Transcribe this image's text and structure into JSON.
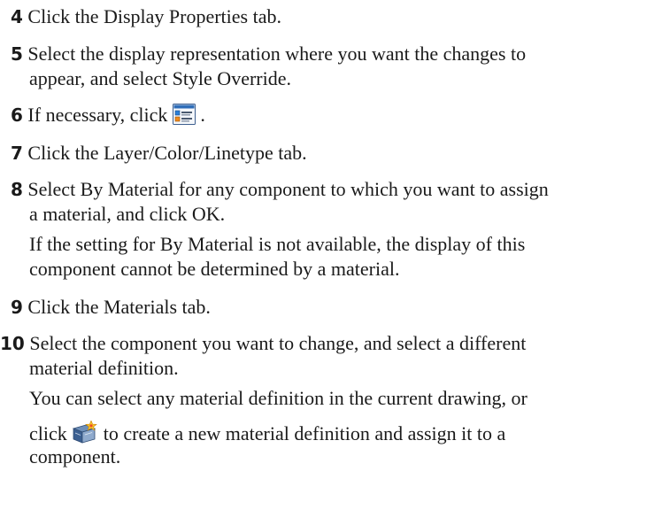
{
  "steps": [
    {
      "num": "4",
      "text": " Click the Display Properties tab."
    },
    {
      "num": "5",
      "line1": " Select the display representation where you want the changes to",
      "line2": "appear, and select Style Override."
    },
    {
      "num": "6",
      "before": " If necessary, click ",
      "after": " .",
      "icon": "display-properties-icon"
    },
    {
      "num": "7",
      "text": " Click the Layer/Color/Linetype tab."
    },
    {
      "num": "8",
      "line1": " Select By Material for any component to which you want to assign",
      "line2": "a material, and click OK.",
      "note1": "If the setting for By Material is not available, the display of this",
      "note2": "component cannot be determined by a material."
    },
    {
      "num": "9",
      "text": " Click the Materials tab."
    },
    {
      "num": "10",
      "line1": " Select the component you want to change, and select a different",
      "line2": "material definition.",
      "note1": "You can select any material definition in the current drawing, or",
      "note2_before": "click ",
      "note2_after": " to create a new material definition and assign it to a",
      "note3": "component.",
      "icon": "new-material-icon"
    }
  ]
}
